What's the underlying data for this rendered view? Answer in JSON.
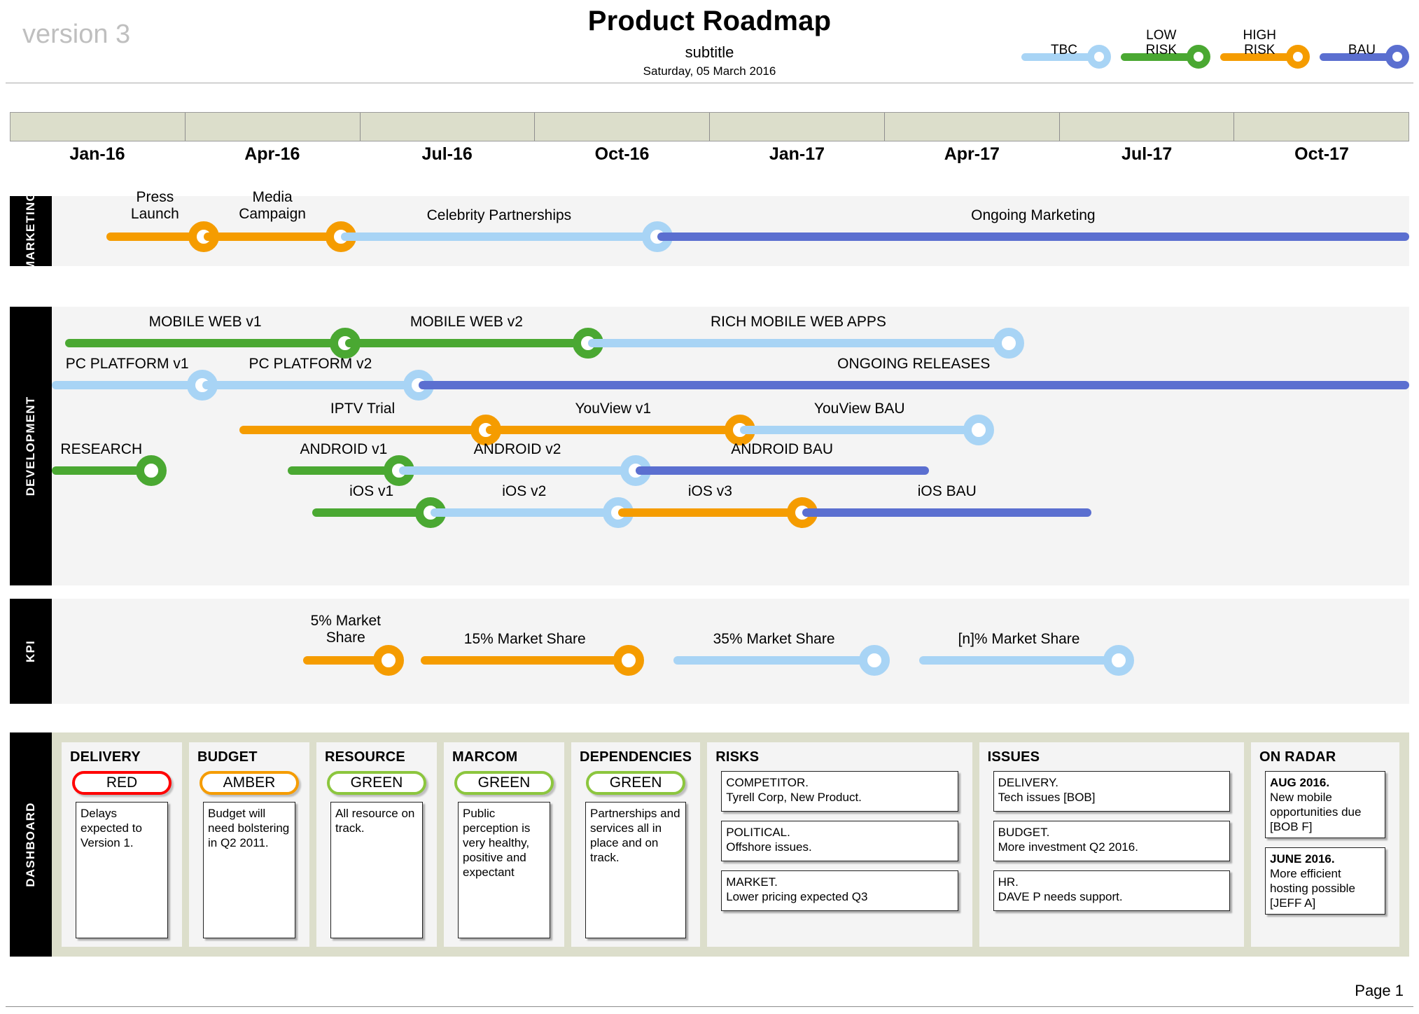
{
  "header": {
    "version": "version 3",
    "title": "Product Roadmap",
    "subtitle": "subtitle",
    "date": "Saturday, 05 March 2016"
  },
  "legend": {
    "items": [
      {
        "label": "TBC",
        "color": "#a8d4f5"
      },
      {
        "label": "LOW\nRISK",
        "color": "#4aa832"
      },
      {
        "label": "HIGH\nRISK",
        "color": "#f59c00"
      },
      {
        "label": "BAU",
        "color": "#5b6fd0"
      }
    ]
  },
  "timeline": {
    "ticks": [
      "Jan-16",
      "Apr-16",
      "Jul-16",
      "Oct-16",
      "Jan-17",
      "Apr-17",
      "Jul-17",
      "Oct-17"
    ]
  },
  "lanes": [
    {
      "name": "MARKETING",
      "rows": [
        {
          "items": [
            {
              "label": "Press\nLaunch",
              "color": "#f59c00",
              "start": 4.0,
              "end": 11.2
            },
            {
              "label": "Media\nCampaign",
              "color": "#f59c00",
              "start": 11.2,
              "end": 21.3
            },
            {
              "label": "Celebrity Partnerships",
              "color": "#a8d4f5",
              "start": 21.3,
              "end": 44.6
            },
            {
              "label": "Ongoing Marketing",
              "color": "#5b6fd0",
              "start": 44.6,
              "end": 100.0,
              "no_node": true
            }
          ]
        }
      ]
    },
    {
      "name": "DEVELOPMENT",
      "rows": [
        {
          "items": [
            {
              "label": "MOBILE WEB v1",
              "color": "#4aa832",
              "start": 1.0,
              "end": 21.6
            },
            {
              "label": "MOBILE WEB v2",
              "color": "#4aa832",
              "start": 21.6,
              "end": 39.5
            },
            {
              "label": "RICH MOBILE WEB APPS",
              "color": "#a8d4f5",
              "start": 39.5,
              "end": 70.5
            }
          ]
        },
        {
          "items": [
            {
              "label": "PC PLATFORM v1",
              "color": "#a8d4f5",
              "start": 0.0,
              "end": 11.1
            },
            {
              "label": "PC PLATFORM v2",
              "color": "#a8d4f5",
              "start": 11.1,
              "end": 27.0
            },
            {
              "label": "ONGOING RELEASES",
              "color": "#5b6fd0",
              "start": 27.0,
              "end": 100.0,
              "no_node": true
            }
          ]
        },
        {
          "items": [
            {
              "label": "IPTV Trial",
              "color": "#f59c00",
              "start": 13.8,
              "end": 32.0
            },
            {
              "label": "YouView v1",
              "color": "#f59c00",
              "start": 32.0,
              "end": 50.7
            },
            {
              "label": "YouView BAU",
              "color": "#a8d4f5",
              "start": 50.7,
              "end": 68.3
            }
          ]
        },
        {
          "items": [
            {
              "label": "RESEARCH",
              "color": "#4aa832",
              "start": 0.0,
              "end": 7.3,
              "gap_after": true
            },
            {
              "label": "ANDROID v1",
              "color": "#4aa832",
              "start": 17.4,
              "end": 25.6
            },
            {
              "label": "ANDROID v2",
              "color": "#a8d4f5",
              "start": 25.6,
              "end": 43.0
            },
            {
              "label": "ANDROID BAU",
              "color": "#5b6fd0",
              "start": 43.0,
              "end": 64.6,
              "no_node": true
            }
          ]
        },
        {
          "items": [
            {
              "label": "iOS v1",
              "color": "#4aa832",
              "start": 19.2,
              "end": 27.9
            },
            {
              "label": "iOS v2",
              "color": "#a8d4f5",
              "start": 27.9,
              "end": 41.7
            },
            {
              "label": "iOS v3",
              "color": "#f59c00",
              "start": 41.7,
              "end": 55.3
            },
            {
              "label": "iOS BAU",
              "color": "#5b6fd0",
              "start": 55.3,
              "end": 76.6,
              "no_node": true
            }
          ]
        }
      ]
    },
    {
      "name": "KPI",
      "rows": [
        {
          "items": [
            {
              "label": "5% Market\nShare",
              "color": "#f59c00",
              "start": 18.5,
              "end": 24.8
            },
            {
              "label": "15% Market Share",
              "color": "#f59c00",
              "start": 27.2,
              "end": 42.5,
              "gap_before": true
            },
            {
              "label": "35% Market Share",
              "color": "#a8d4f5",
              "start": 45.8,
              "end": 60.6,
              "gap_before": true
            },
            {
              "label": "[n]% Market Share",
              "color": "#a8d4f5",
              "start": 63.9,
              "end": 78.6,
              "gap_before": true
            }
          ]
        }
      ]
    }
  ],
  "dashboard": {
    "name": "DASHBOARD",
    "rag_cards": [
      {
        "title": "DELIVERY",
        "status": "RED",
        "status_color": "#ff0000",
        "note": "Delays expected to Version 1."
      },
      {
        "title": "BUDGET",
        "status": "AMBER",
        "status_color": "#f59c00",
        "note": "Budget will need bolstering in Q2 2011."
      },
      {
        "title": "RESOURCE",
        "status": "GREEN",
        "status_color": "#8cc63e",
        "note": "All resource on track."
      },
      {
        "title": "MARCOM",
        "status": "GREEN",
        "status_color": "#8cc63e",
        "note": "Public perception is very healthy, positive and expectant"
      },
      {
        "title": "DEPENDENCIES",
        "status": "GREEN",
        "status_color": "#8cc63e",
        "note": "Partnerships and services all in place and on track."
      }
    ],
    "list_cards": [
      {
        "title": "RISKS",
        "notes": [
          {
            "head": "COMPETITOR.",
            "body": "Tyrell Corp, New Product."
          },
          {
            "head": "POLITICAL.",
            "body": "Offshore issues."
          },
          {
            "head": "MARKET.",
            "body": "Lower pricing expected Q3"
          }
        ]
      },
      {
        "title": "ISSUES",
        "notes": [
          {
            "head": "DELIVERY.",
            "body": "Tech issues [BOB]"
          },
          {
            "head": "BUDGET.",
            "body": "More investment Q2 2016."
          },
          {
            "head": "HR.",
            "body": "DAVE P needs support."
          }
        ]
      },
      {
        "title": "ON RADAR",
        "bold_head": true,
        "notes": [
          {
            "head": "AUG 2016.",
            "body": "New mobile opportunities due [BOB F]"
          },
          {
            "head": "JUNE 2016.",
            "body": "More efficient hosting possible [JEFF A]"
          }
        ]
      }
    ]
  },
  "footer": {
    "page": "Page 1"
  }
}
